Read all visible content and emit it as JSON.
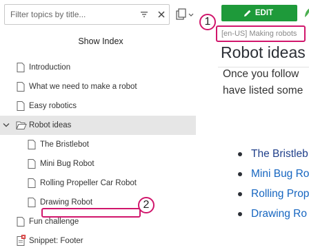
{
  "sidebar": {
    "filter_placeholder": "Filter topics by title...",
    "show_index_label": "Show Index",
    "tree": [
      {
        "label": "Introduction",
        "type": "topic"
      },
      {
        "label": "What we need to make a robot",
        "type": "topic"
      },
      {
        "label": "Easy robotics",
        "type": "topic"
      },
      {
        "label": "Robot ideas",
        "type": "folder",
        "expanded": true,
        "selected": true
      },
      {
        "label": "The Bristlebot",
        "type": "topic",
        "child": true
      },
      {
        "label": "Mini Bug Robot",
        "type": "topic",
        "child": true
      },
      {
        "label": "Rolling Propeller Car Robot",
        "type": "topic",
        "child": true
      },
      {
        "label": "Drawing Robot",
        "type": "topic",
        "child": true
      },
      {
        "label": "Fun challenge",
        "type": "topic"
      },
      {
        "label": "Snippet: Footer",
        "type": "snippet"
      }
    ]
  },
  "content": {
    "edit_label": "EDIT",
    "breadcrumb": "[en-US] Making robots",
    "title": "Robot ideas",
    "body_line1": "Once you follow",
    "body_line2": "have listed some",
    "bullets": [
      "The Bristleb",
      "Mini Bug Ro",
      "Rolling Prop",
      "Drawing Ro"
    ]
  },
  "annotations": {
    "callout1": "1",
    "callout2": "2"
  },
  "colors": {
    "accent_green": "#1e9a3a",
    "callout_magenta": "#d0156b",
    "link_blue": "#1565c0",
    "selected_row": "#e6e6e6"
  }
}
